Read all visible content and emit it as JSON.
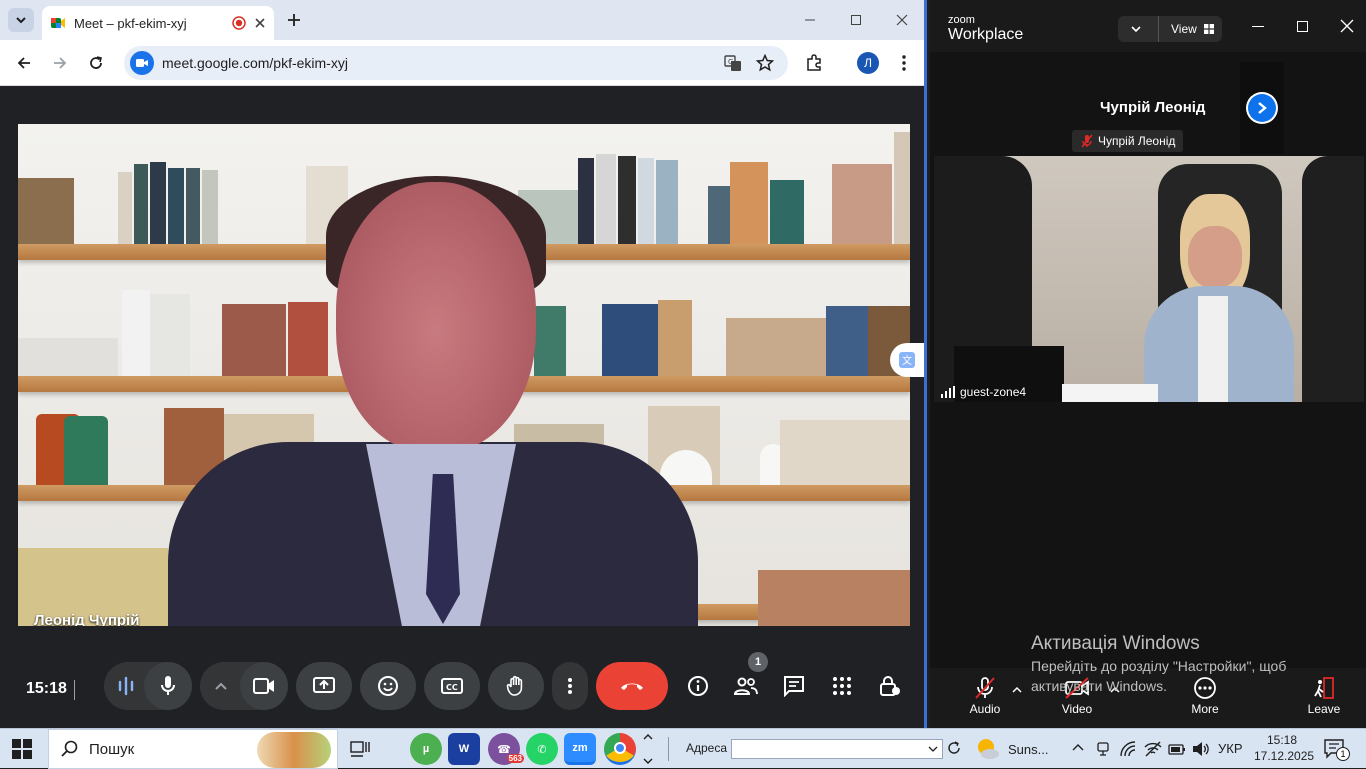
{
  "chrome": {
    "tab_title": "Meet – pkf-ekim-xyj",
    "url": "meet.google.com/pkf-ekim-xyj",
    "profile_initial": "Л"
  },
  "meet": {
    "participant_name": "Леонід Чупрій",
    "clock": "15:18",
    "people_count": "1"
  },
  "zoom": {
    "brand_small": "zoom",
    "brand_big": "Workplace",
    "view_label": "View",
    "active_speaker": "Чупрій Леонід",
    "muted_label": "Чупрій Леонід",
    "video_tile_name": "guest-zone4",
    "controls": {
      "audio": "Audio",
      "video": "Video",
      "more": "More",
      "leave": "Leave"
    }
  },
  "watermark": {
    "title": "Активація Windows",
    "line1": "Перейдіть до розділу \"Настройки\", щоб",
    "line2": "активувати Windows."
  },
  "taskbar": {
    "search_label": "Пошук",
    "zm_badge": "zm",
    "viber_badge": "563",
    "address_label": "Адреса",
    "weather": "Suns...",
    "language": "УКР",
    "time": "15:18",
    "date": "17.12.2025",
    "notifications": "1"
  },
  "colors": {
    "meet_bg": "#202124",
    "end_call": "#ea4335",
    "zoom_bg": "#1a1a1a",
    "accent_blue": "#1a73e8"
  }
}
